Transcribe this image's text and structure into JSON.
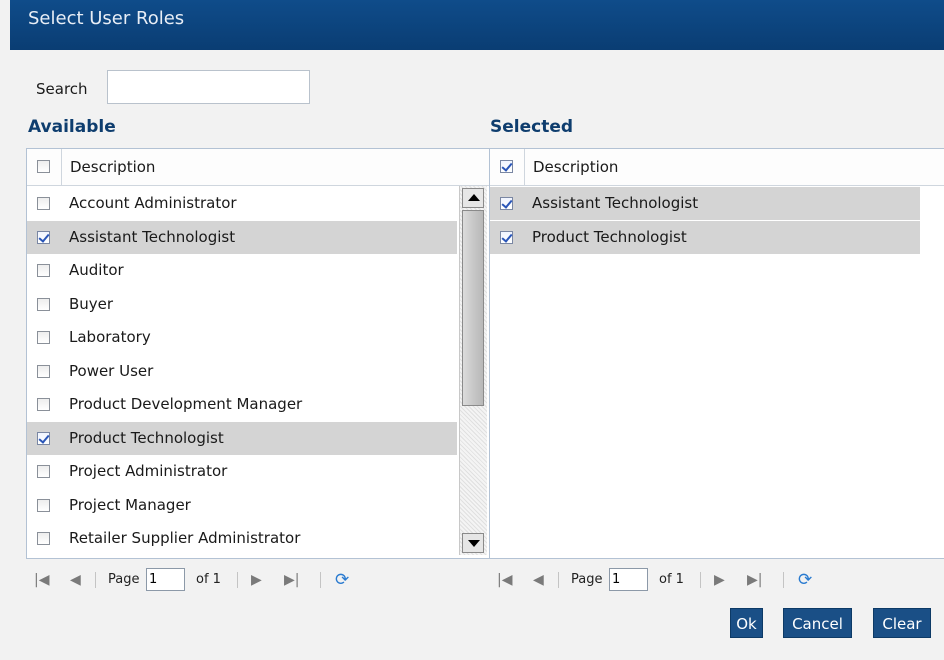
{
  "dialog": {
    "title": "Select User Roles"
  },
  "search": {
    "label": "Search",
    "value": ""
  },
  "available": {
    "title": "Available",
    "header": "Description",
    "rows": [
      {
        "label": "Account Administrator",
        "checked": false
      },
      {
        "label": "Assistant Technologist",
        "checked": true
      },
      {
        "label": "Auditor",
        "checked": false
      },
      {
        "label": "Buyer",
        "checked": false
      },
      {
        "label": "Laboratory",
        "checked": false
      },
      {
        "label": "Power User",
        "checked": false
      },
      {
        "label": "Product Development Manager",
        "checked": false
      },
      {
        "label": "Product Technologist",
        "checked": true
      },
      {
        "label": "Project Administrator",
        "checked": false
      },
      {
        "label": "Project Manager",
        "checked": false
      },
      {
        "label": "Retailer Supplier Administrator",
        "checked": false
      }
    ],
    "pager": {
      "page_label": "Page",
      "page_value": "1",
      "of_label": "of 1"
    }
  },
  "selected": {
    "title": "Selected",
    "header": "Description",
    "header_checked": true,
    "rows": [
      {
        "label": "Assistant Technologist",
        "checked": true
      },
      {
        "label": "Product Technologist",
        "checked": true
      }
    ],
    "pager": {
      "page_label": "Page",
      "page_value": "1",
      "of_label": "of 1"
    }
  },
  "buttons": {
    "ok": "Ok",
    "cancel": "Cancel",
    "clear": "Clear"
  },
  "colors": {
    "title_bar": "#0f4c8a",
    "button": "#1a4f86",
    "selected_row": "#d4d4d4"
  },
  "icons": {
    "first": "first-page-icon",
    "prev": "prev-page-icon",
    "next": "next-page-icon",
    "last": "last-page-icon",
    "refresh": "refresh-icon"
  }
}
